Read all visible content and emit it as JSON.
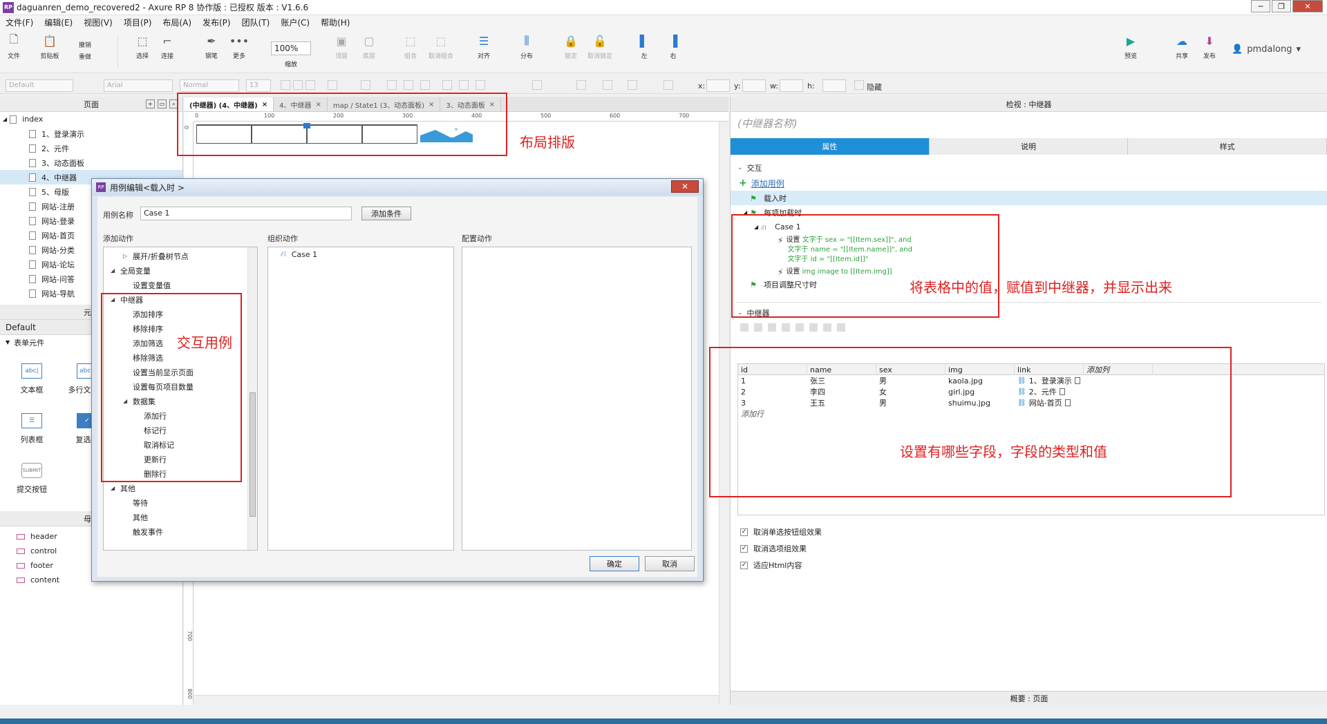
{
  "window": {
    "title": "daguanren_demo_recovered2 - Axure RP 8 协作版 : 已授权 版本 : V1.6.6",
    "app_icon": "RP"
  },
  "menu": [
    "文件(F)",
    "编辑(E)",
    "视图(V)",
    "项目(P)",
    "布局(A)",
    "发布(P)",
    "团队(T)",
    "账户(C)",
    "帮助(H)"
  ],
  "toolbar": {
    "file": "文件",
    "clipboard": "剪贴板",
    "undo": "撤销",
    "redo": "重做",
    "select": "选择",
    "connect": "连接",
    "pen": "钢笔",
    "more": "更多",
    "zoom_value": "100%",
    "zoom_label": "缩放",
    "top": "顶层",
    "bottom": "底层",
    "group": "组合",
    "ungroup": "取消组合",
    "align": "对齐",
    "distribute": "分布",
    "lock": "锁定",
    "unlock": "取消锁定",
    "left": "左",
    "right": "右",
    "preview": "预览",
    "share": "共享",
    "publish": "发布",
    "user": "pmdalong"
  },
  "formatbar": {
    "style": "Default",
    "font": "Arial",
    "weight": "Normal",
    "size": "13",
    "x": "x:",
    "y": "y:",
    "w": "w:",
    "h": "h:",
    "hidden": "隐藏"
  },
  "pages_panel": {
    "title": "页面",
    "root": "index",
    "items": [
      "1、登录演示",
      "2、元件",
      "3、动态面板",
      "4、中继器",
      "5、母版",
      "网站-注册",
      "网站-登录",
      "网站-首页",
      "网站-分类",
      "网站-论坛",
      "网站-问答",
      "网站-导航"
    ],
    "selected": "4、中继器"
  },
  "widgets_panel": {
    "title": "元件",
    "library": "Default",
    "category": "表单元件",
    "items": [
      {
        "label": "文本框",
        "icon": "abc"
      },
      {
        "label": "多行文本框",
        "icon": "abcd"
      },
      {
        "label": "列表框",
        "icon": "list"
      },
      {
        "label": "复选框",
        "icon": "check"
      },
      {
        "label": "提交按钮",
        "icon": "submit"
      }
    ]
  },
  "masters_panel": {
    "title": "母版",
    "items": [
      "header",
      "control",
      "footer",
      "content"
    ]
  },
  "canvas": {
    "tabs": [
      {
        "label": "(中继器) (4、中继器)",
        "active": true
      },
      {
        "label": "4、中继器",
        "active": false
      },
      {
        "label": "map / State1 (3、动态面板)",
        "active": false
      },
      {
        "label": "3、动态面板",
        "active": false
      }
    ],
    "ruler_h": [
      "0",
      "100",
      "200",
      "300",
      "400",
      "500",
      "600",
      "700"
    ],
    "ruler_v": [
      "0",
      "700",
      "800"
    ]
  },
  "inspector": {
    "title": "检视 : 中继器",
    "name_placeholder": "(中继器名称)",
    "tabs": [
      "属性",
      "说明",
      "样式"
    ],
    "interaction_title": "交互",
    "add_case": "添加用例",
    "events": {
      "on_load": "载入时",
      "on_item_load": "每项加载时",
      "case": "Case 1",
      "action1_key": "设置",
      "action1_lines": [
        "文字于 sex = \"[[Item.sex]]\", and",
        "文字于 name = \"[[Item.name]]\", and",
        "文字于 id = \"[[Item.id]]\""
      ],
      "action2_key": "设置",
      "action2": "img image to [[Item.img]]",
      "on_resize": "项目调整尺寸时"
    },
    "repeater_title": "中继器",
    "dataset": {
      "columns": [
        "id",
        "name",
        "sex",
        "img",
        "link",
        "添加列"
      ],
      "rows": [
        [
          "1",
          "张三",
          "男",
          "kaola.jpg",
          "1、登录演示"
        ],
        [
          "2",
          "李四",
          "女",
          "girl.jpg",
          "2、元件"
        ],
        [
          "3",
          "王五",
          "男",
          "shuimu.jpg",
          "网站-首页"
        ]
      ],
      "add_row": "添加行"
    },
    "checkboxes": [
      "取消单选按钮组效果",
      "取消选项组效果",
      "适应Html内容"
    ],
    "bottom": "概要 : 页面"
  },
  "dialog": {
    "title": "用例编辑<载入时 >",
    "case_name_label": "用例名称",
    "case_name_value": "Case 1",
    "add_condition": "添加条件",
    "col_add_action": "添加动作",
    "col_organize": "组织动作",
    "col_configure": "配置动作",
    "actions": [
      {
        "label": "展开/折叠树节点",
        "level": 2,
        "tri": "right"
      },
      {
        "label": "全局变量",
        "level": 0,
        "tri": "down"
      },
      {
        "label": "设置变量值",
        "level": 2,
        "tri": ""
      },
      {
        "label": "中继器",
        "level": 0,
        "tri": "down"
      },
      {
        "label": "添加排序",
        "level": 1,
        "tri": ""
      },
      {
        "label": "移除排序",
        "level": 1,
        "tri": ""
      },
      {
        "label": "添加筛选",
        "level": 1,
        "tri": ""
      },
      {
        "label": "移除筛选",
        "level": 1,
        "tri": ""
      },
      {
        "label": "设置当前显示页面",
        "level": 1,
        "tri": ""
      },
      {
        "label": "设置每页项目数量",
        "level": 1,
        "tri": ""
      },
      {
        "label": "数据集",
        "level": 1,
        "tri": "down"
      },
      {
        "label": "添加行",
        "level": 2,
        "tri": ""
      },
      {
        "label": "标记行",
        "level": 2,
        "tri": ""
      },
      {
        "label": "取消标记",
        "level": 2,
        "tri": ""
      },
      {
        "label": "更新行",
        "level": 2,
        "tri": ""
      },
      {
        "label": "删除行",
        "level": 2,
        "tri": ""
      },
      {
        "label": "其他",
        "level": 0,
        "tri": "down"
      },
      {
        "label": "等待",
        "level": 1,
        "tri": ""
      },
      {
        "label": "其他",
        "level": 1,
        "tri": ""
      },
      {
        "label": "触发事件",
        "level": 1,
        "tri": ""
      }
    ],
    "organize_case": "Case 1",
    "ok": "确定",
    "cancel": "取消"
  },
  "annotations": {
    "layout": "布局排版",
    "interaction_case": "交互用例",
    "assign": "将表格中的值，赋值到中继器，并显示出来",
    "fields": "设置有哪些字段，字段的类型和值"
  },
  "colors": {
    "accent": "#1e8fd8",
    "annotation": "#e02020",
    "green": "#2aa23a"
  }
}
